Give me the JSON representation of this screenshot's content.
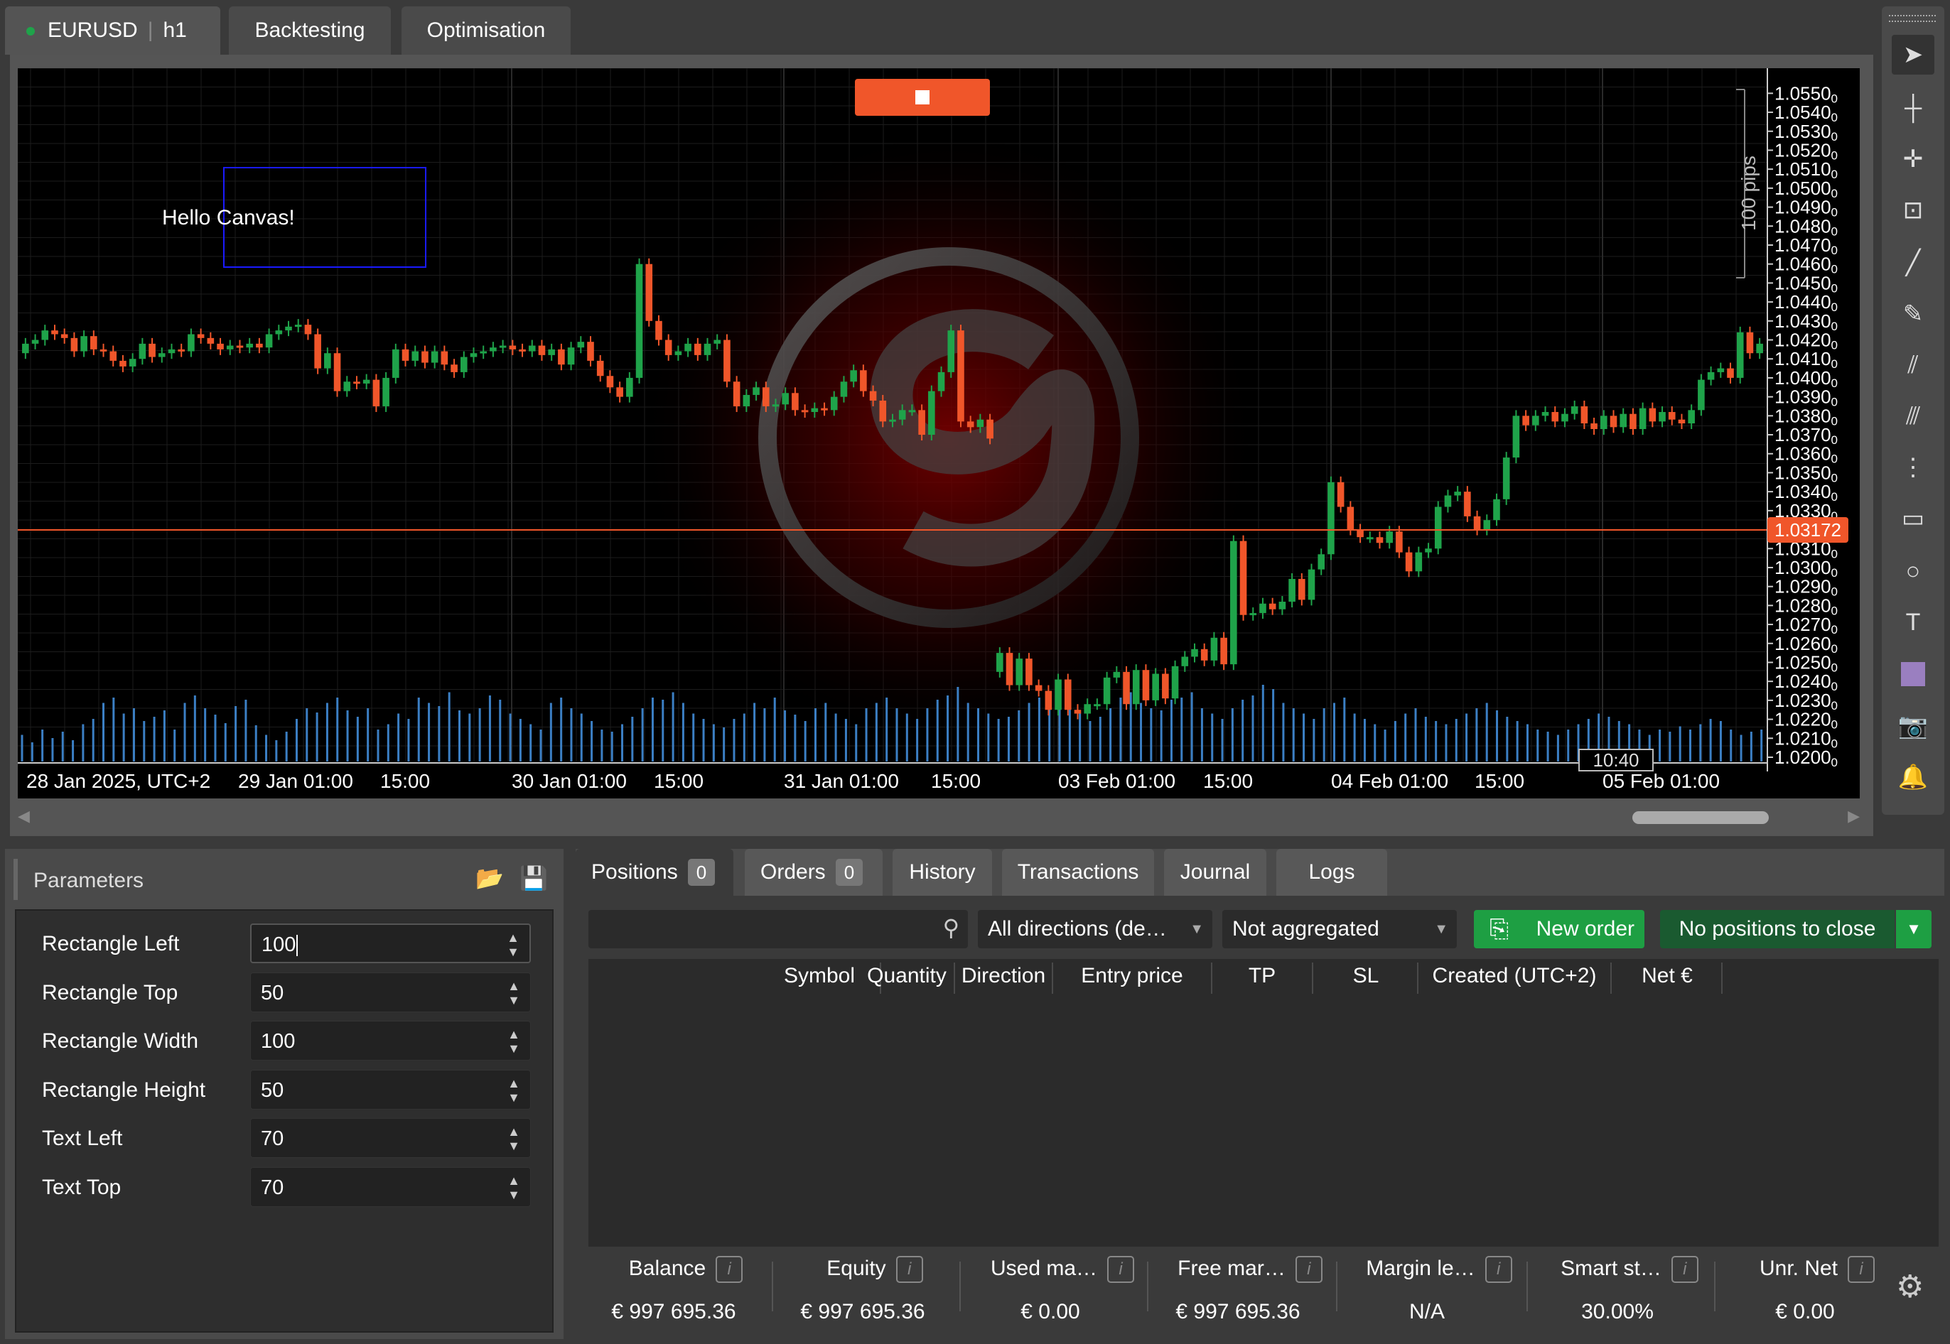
{
  "top_tabs": {
    "symbol": "EURUSD",
    "timeframe": "h1",
    "backtesting": "Backtesting",
    "optimisation": "Optimisation"
  },
  "chart": {
    "canvas_text": "Hello Canvas!",
    "current_price": "1.03172",
    "pips_label": "100 pips",
    "time_marker": "10:40",
    "y_ticks": [
      "1.0550",
      "1.0540",
      "1.0530",
      "1.0520",
      "1.0510",
      "1.0500",
      "1.0490",
      "1.0480",
      "1.0470",
      "1.0460",
      "1.0450",
      "1.0440",
      "1.0430",
      "1.0420",
      "1.0410",
      "1.0400",
      "1.0390",
      "1.0380",
      "1.0370",
      "1.0360",
      "1.0350",
      "1.0340",
      "1.0330",
      "1.0310",
      "1.0300",
      "1.0290",
      "1.0280",
      "1.0270",
      "1.0260",
      "1.0250",
      "1.0240",
      "1.0230",
      "1.0220",
      "1.0210",
      "1.0200"
    ],
    "y_tick_suffix": "0",
    "x_ticks": [
      "28 Jan 2025, UTC+2",
      "29 Jan 01:00",
      "15:00",
      "30 Jan 01:00",
      "15:00",
      "31 Jan 01:00",
      "15:00",
      "03 Feb 01:00",
      "15:00",
      "04 Feb 01:00",
      "15:00",
      "05 Feb 01:00"
    ],
    "colors": {
      "bull": "#1fa34a",
      "bear": "#f0562a",
      "price_line": "#f0562a",
      "volume": "#3b7fc4",
      "rect": "#1a1aff"
    }
  },
  "chart_data": {
    "type": "candlestick",
    "ylim": [
      1.02,
      1.0555
    ],
    "candles": [
      {
        "o": 1.0413,
        "c": 1.0418
      },
      {
        "o": 1.0418,
        "c": 1.042
      },
      {
        "o": 1.042,
        "c": 1.0425
      },
      {
        "o": 1.0425,
        "c": 1.0423
      },
      {
        "o": 1.0423,
        "c": 1.0421
      },
      {
        "o": 1.0421,
        "c": 1.0414
      },
      {
        "o": 1.0414,
        "c": 1.0422
      },
      {
        "o": 1.0422,
        "c": 1.0415
      },
      {
        "o": 1.0415,
        "c": 1.0414
      },
      {
        "o": 1.0414,
        "c": 1.0409
      },
      {
        "o": 1.0409,
        "c": 1.0406
      },
      {
        "o": 1.0406,
        "c": 1.041
      },
      {
        "o": 1.041,
        "c": 1.0418
      },
      {
        "o": 1.0418,
        "c": 1.0411
      },
      {
        "o": 1.0411,
        "c": 1.0413
      },
      {
        "o": 1.0413,
        "c": 1.0415
      },
      {
        "o": 1.0415,
        "c": 1.0414
      },
      {
        "o": 1.0414,
        "c": 1.0423
      },
      {
        "o": 1.0423,
        "c": 1.0421
      },
      {
        "o": 1.0421,
        "c": 1.0418
      },
      {
        "o": 1.0418,
        "c": 1.0415
      },
      {
        "o": 1.0415,
        "c": 1.0417
      },
      {
        "o": 1.0417,
        "c": 1.0416
      },
      {
        "o": 1.0416,
        "c": 1.0418
      },
      {
        "o": 1.0418,
        "c": 1.0416
      },
      {
        "o": 1.0416,
        "c": 1.0423
      },
      {
        "o": 1.0423,
        "c": 1.0425
      },
      {
        "o": 1.0425,
        "c": 1.0427
      },
      {
        "o": 1.0427,
        "c": 1.0428
      },
      {
        "o": 1.0428,
        "c": 1.0423
      },
      {
        "o": 1.0423,
        "c": 1.0405
      },
      {
        "o": 1.0405,
        "c": 1.0413
      },
      {
        "o": 1.0413,
        "c": 1.0393
      },
      {
        "o": 1.0393,
        "c": 1.0398
      },
      {
        "o": 1.0398,
        "c": 1.0397
      },
      {
        "o": 1.0397,
        "c": 1.0399
      },
      {
        "o": 1.0399,
        "c": 1.0385
      },
      {
        "o": 1.0385,
        "c": 1.04
      },
      {
        "o": 1.04,
        "c": 1.0415
      },
      {
        "o": 1.0415,
        "c": 1.0409
      },
      {
        "o": 1.0409,
        "c": 1.0414
      },
      {
        "o": 1.0414,
        "c": 1.0408
      },
      {
        "o": 1.0408,
        "c": 1.0414
      },
      {
        "o": 1.0414,
        "c": 1.0407
      },
      {
        "o": 1.0407,
        "c": 1.0403
      },
      {
        "o": 1.0403,
        "c": 1.0411
      },
      {
        "o": 1.0411,
        "c": 1.0413
      },
      {
        "o": 1.0413,
        "c": 1.0414
      },
      {
        "o": 1.0414,
        "c": 1.0416
      },
      {
        "o": 1.0416,
        "c": 1.0417
      },
      {
        "o": 1.0417,
        "c": 1.0415
      },
      {
        "o": 1.0415,
        "c": 1.0414
      },
      {
        "o": 1.0414,
        "c": 1.0417
      },
      {
        "o": 1.0417,
        "c": 1.0412
      },
      {
        "o": 1.0412,
        "c": 1.0415
      },
      {
        "o": 1.0415,
        "c": 1.0407
      },
      {
        "o": 1.0407,
        "c": 1.0416
      },
      {
        "o": 1.0416,
        "c": 1.0419
      },
      {
        "o": 1.0419,
        "c": 1.0409
      },
      {
        "o": 1.0409,
        "c": 1.0401
      },
      {
        "o": 1.0401,
        "c": 1.0395
      },
      {
        "o": 1.0395,
        "c": 1.039
      },
      {
        "o": 1.039,
        "c": 1.04
      },
      {
        "o": 1.04,
        "c": 1.046
      },
      {
        "o": 1.046,
        "c": 1.043
      },
      {
        "o": 1.043,
        "c": 1.042
      },
      {
        "o": 1.042,
        "c": 1.0412
      },
      {
        "o": 1.0412,
        "c": 1.0414
      },
      {
        "o": 1.0414,
        "c": 1.0418
      },
      {
        "o": 1.0418,
        "c": 1.0412
      },
      {
        "o": 1.0412,
        "c": 1.0418
      },
      {
        "o": 1.0418,
        "c": 1.042
      },
      {
        "o": 1.042,
        "c": 1.0398
      },
      {
        "o": 1.0398,
        "c": 1.0385
      },
      {
        "o": 1.0385,
        "c": 1.0391
      },
      {
        "o": 1.0391,
        "c": 1.0395
      },
      {
        "o": 1.0395,
        "c": 1.0385
      },
      {
        "o": 1.0385,
        "c": 1.0386
      },
      {
        "o": 1.0386,
        "c": 1.0392
      },
      {
        "o": 1.0392,
        "c": 1.0383
      },
      {
        "o": 1.0383,
        "c": 1.0382
      },
      {
        "o": 1.0382,
        "c": 1.0384
      },
      {
        "o": 1.0384,
        "c": 1.0383
      },
      {
        "o": 1.0383,
        "c": 1.039
      },
      {
        "o": 1.039,
        "c": 1.0398
      },
      {
        "o": 1.0398,
        "c": 1.0404
      },
      {
        "o": 1.0404,
        "c": 1.0393
      },
      {
        "o": 1.0393,
        "c": 1.0388
      },
      {
        "o": 1.0388,
        "c": 1.0377
      },
      {
        "o": 1.0377,
        "c": 1.0378
      },
      {
        "o": 1.0378,
        "c": 1.0383
      },
      {
        "o": 1.0383,
        "c": 1.0383
      },
      {
        "o": 1.0383,
        "c": 1.037
      },
      {
        "o": 1.037,
        "c": 1.0393
      },
      {
        "o": 1.0393,
        "c": 1.0403
      },
      {
        "o": 1.0403,
        "c": 1.0425
      },
      {
        "o": 1.0425,
        "c": 1.0377
      },
      {
        "o": 1.0377,
        "c": 1.0374
      },
      {
        "o": 1.0374,
        "c": 1.0378
      },
      {
        "o": 1.0378,
        "c": 1.0368
      },
      {
        "o": 1.0245,
        "c": 1.0255
      },
      {
        "o": 1.0255,
        "c": 1.0238
      },
      {
        "o": 1.0238,
        "c": 1.0252
      },
      {
        "o": 1.0252,
        "c": 1.0238
      },
      {
        "o": 1.0238,
        "c": 1.0235
      },
      {
        "o": 1.0235,
        "c": 1.0225
      },
      {
        "o": 1.0225,
        "c": 1.0241
      },
      {
        "o": 1.0241,
        "c": 1.0225
      },
      {
        "o": 1.0225,
        "c": 1.0223
      },
      {
        "o": 1.0223,
        "c": 1.0228
      },
      {
        "o": 1.0228,
        "c": 1.0228
      },
      {
        "o": 1.0228,
        "c": 1.0242
      },
      {
        "o": 1.0242,
        "c": 1.0245
      },
      {
        "o": 1.0245,
        "c": 1.0228
      },
      {
        "o": 1.0228,
        "c": 1.0246
      },
      {
        "o": 1.0246,
        "c": 1.023
      },
      {
        "o": 1.023,
        "c": 1.0244
      },
      {
        "o": 1.0244,
        "c": 1.0231
      },
      {
        "o": 1.0231,
        "c": 1.0248
      },
      {
        "o": 1.0248,
        "c": 1.0253
      },
      {
        "o": 1.0253,
        "c": 1.0257
      },
      {
        "o": 1.0257,
        "c": 1.0251
      },
      {
        "o": 1.0251,
        "c": 1.0263
      },
      {
        "o": 1.0263,
        "c": 1.0249
      },
      {
        "o": 1.0249,
        "c": 1.0314
      },
      {
        "o": 1.0314,
        "c": 1.0275
      },
      {
        "o": 1.0275,
        "c": 1.0276
      },
      {
        "o": 1.0276,
        "c": 1.0281
      },
      {
        "o": 1.0281,
        "c": 1.0278
      },
      {
        "o": 1.0278,
        "c": 1.0282
      },
      {
        "o": 1.0282,
        "c": 1.0294
      },
      {
        "o": 1.0294,
        "c": 1.0283
      },
      {
        "o": 1.0283,
        "c": 1.0299
      },
      {
        "o": 1.0299,
        "c": 1.0307
      },
      {
        "o": 1.0307,
        "c": 1.0345
      },
      {
        "o": 1.0345,
        "c": 1.0332
      },
      {
        "o": 1.0332,
        "c": 1.032
      },
      {
        "o": 1.032,
        "c": 1.0316
      },
      {
        "o": 1.0316,
        "c": 1.0316
      },
      {
        "o": 1.0316,
        "c": 1.0313
      },
      {
        "o": 1.0313,
        "c": 1.0319
      },
      {
        "o": 1.0319,
        "c": 1.0308
      },
      {
        "o": 1.0308,
        "c": 1.0298
      },
      {
        "o": 1.0298,
        "c": 1.0308
      },
      {
        "o": 1.0308,
        "c": 1.031
      },
      {
        "o": 1.031,
        "c": 1.0332
      },
      {
        "o": 1.0332,
        "c": 1.0338
      },
      {
        "o": 1.0338,
        "c": 1.034
      },
      {
        "o": 1.034,
        "c": 1.0327
      },
      {
        "o": 1.0327,
        "c": 1.032
      },
      {
        "o": 1.032,
        "c": 1.0325
      },
      {
        "o": 1.0325,
        "c": 1.0336
      },
      {
        "o": 1.0336,
        "c": 1.0358
      },
      {
        "o": 1.0358,
        "c": 1.038
      },
      {
        "o": 1.038,
        "c": 1.0375
      },
      {
        "o": 1.0375,
        "c": 1.038
      },
      {
        "o": 1.038,
        "c": 1.0382
      },
      {
        "o": 1.0382,
        "c": 1.0377
      },
      {
        "o": 1.0377,
        "c": 1.0381
      },
      {
        "o": 1.0381,
        "c": 1.0385
      },
      {
        "o": 1.0385,
        "c": 1.0376
      },
      {
        "o": 1.0376,
        "c": 1.0373
      },
      {
        "o": 1.0373,
        "c": 1.038
      },
      {
        "o": 1.038,
        "c": 1.0374
      },
      {
        "o": 1.0374,
        "c": 1.0381
      },
      {
        "o": 1.0381,
        "c": 1.0373
      },
      {
        "o": 1.0373,
        "c": 1.0384
      },
      {
        "o": 1.0384,
        "c": 1.0377
      },
      {
        "o": 1.0377,
        "c": 1.0382
      },
      {
        "o": 1.0382,
        "c": 1.0378
      },
      {
        "o": 1.0378,
        "c": 1.0376
      },
      {
        "o": 1.0376,
        "c": 1.0383
      },
      {
        "o": 1.0383,
        "c": 1.0399
      },
      {
        "o": 1.0399,
        "c": 1.0403
      },
      {
        "o": 1.0403,
        "c": 1.0405
      },
      {
        "o": 1.0405,
        "c": 1.04
      },
      {
        "o": 1.04,
        "c": 1.0424
      },
      {
        "o": 1.0424,
        "c": 1.0413
      },
      {
        "o": 1.0413,
        "c": 1.0418
      }
    ],
    "volume": [
      0.25,
      0.18,
      0.3,
      0.22,
      0.28,
      0.2,
      0.35,
      0.4,
      0.55,
      0.6,
      0.45,
      0.5,
      0.38,
      0.42,
      0.48,
      0.3,
      0.55,
      0.62,
      0.5,
      0.44,
      0.36,
      0.52,
      0.58,
      0.34,
      0.25,
      0.2,
      0.28,
      0.4,
      0.5,
      0.46,
      0.55,
      0.6,
      0.48,
      0.42,
      0.5,
      0.3,
      0.35,
      0.45,
      0.4,
      0.6,
      0.55,
      0.52,
      0.65,
      0.48,
      0.45,
      0.5,
      0.62,
      0.58,
      0.45,
      0.4,
      0.35,
      0.3,
      0.55,
      0.6,
      0.5,
      0.45,
      0.38,
      0.3,
      0.28,
      0.35,
      0.42,
      0.5,
      0.6,
      0.58,
      0.65,
      0.55,
      0.45,
      0.4,
      0.35,
      0.32,
      0.4,
      0.45,
      0.55,
      0.5,
      0.6,
      0.48,
      0.44,
      0.38,
      0.5,
      0.55,
      0.45,
      0.4,
      0.35,
      0.5,
      0.55,
      0.6,
      0.5,
      0.45,
      0.4,
      0.5,
      0.58,
      0.62,
      0.7,
      0.55,
      0.5,
      0.45,
      0.4,
      0.42,
      0.48,
      0.55,
      0.6,
      0.65,
      0.58,
      0.5,
      0.45,
      0.38,
      0.42,
      0.5,
      0.6,
      0.65,
      0.55,
      0.5,
      0.48,
      0.58,
      0.6,
      0.65,
      0.5,
      0.45,
      0.4,
      0.5,
      0.58,
      0.62,
      0.72,
      0.68,
      0.55,
      0.5,
      0.45,
      0.4,
      0.5,
      0.55,
      0.6,
      0.45,
      0.4,
      0.35,
      0.3,
      0.38,
      0.45,
      0.5,
      0.42,
      0.38,
      0.35,
      0.4,
      0.45,
      0.5,
      0.55,
      0.48,
      0.42,
      0.38,
      0.35,
      0.3,
      0.28,
      0.25,
      0.3,
      0.35,
      0.4,
      0.45,
      0.42,
      0.38,
      0.35,
      0.3,
      0.25,
      0.3,
      0.28,
      0.33,
      0.3,
      0.35,
      0.4,
      0.38,
      0.3,
      0.25,
      0.28,
      0.3
    ]
  },
  "toolbar_icons": [
    "pointer-icon",
    "crosshair-icon",
    "crosshair-fine-icon",
    "zoom-icon",
    "trend-line-icon",
    "pen-icon",
    "fibonacci-icon",
    "parallel-channel-icon",
    "fib-levels-icon",
    "rectangle-icon",
    "ellipse-icon",
    "text-icon",
    "color-swatch-icon",
    "camera-icon",
    "bell-icon"
  ],
  "parameters": {
    "title": "Parameters",
    "rows": [
      {
        "label": "Rectangle Left",
        "value": "100"
      },
      {
        "label": "Rectangle Top",
        "value": "50"
      },
      {
        "label": "Rectangle Width",
        "value": "100"
      },
      {
        "label": "Rectangle Height",
        "value": "50"
      },
      {
        "label": "Text Left",
        "value": "70"
      },
      {
        "label": "Text Top",
        "value": "70"
      }
    ]
  },
  "bottom": {
    "tabs": {
      "positions": "Positions",
      "positions_count": "0",
      "orders": "Orders",
      "orders_count": "0",
      "history": "History",
      "transactions": "Transactions",
      "journal": "Journal",
      "logs": "Logs"
    },
    "filters": {
      "search_placeholder": "",
      "directions": "All directions (de…",
      "aggregation": "Not aggregated",
      "new_order": "New order",
      "close_positions": "No positions to close"
    },
    "columns": [
      "Symbol",
      "Quantity",
      "Direction",
      "Entry price",
      "TP",
      "SL",
      "Created (UTC+2)",
      "Net €"
    ],
    "stats": [
      {
        "label": "Balance",
        "value": "€ 997 695.36"
      },
      {
        "label": "Equity",
        "value": "€ 997 695.36"
      },
      {
        "label": "Used ma…",
        "value": "€ 0.00"
      },
      {
        "label": "Free mar…",
        "value": "€ 997 695.36"
      },
      {
        "label": "Margin le…",
        "value": "N/A"
      },
      {
        "label": "Smart st…",
        "value": "30.00%"
      },
      {
        "label": "Unr. Net",
        "value": "€ 0.00"
      }
    ],
    "info_glyph": "i"
  }
}
